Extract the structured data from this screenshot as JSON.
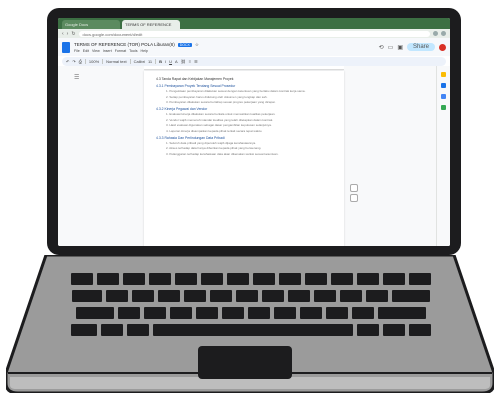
{
  "browser": {
    "tabs": [
      {
        "label": "Google Docs",
        "active": false
      },
      {
        "label": "TERMS OF REFERENCE",
        "active": true
      }
    ],
    "url": "docs.google.com/document/d/edit"
  },
  "docs": {
    "title": "TERMS OF REFERENCE (TOR) POLA Liburan(8)",
    "badge": "DOCX",
    "menus": [
      "File",
      "Edit",
      "View",
      "Insert",
      "Format",
      "Tools",
      "Help"
    ],
    "share_label": "Share"
  },
  "toolbar": {
    "zoom": "100%",
    "style": "Normal text",
    "font": "Calibri",
    "font_size": "11"
  },
  "document": {
    "lines": [
      {
        "kind": "heading",
        "text": "4.3  Tanda Rapat dan Kebijakan Manajemen Proyek"
      },
      {
        "kind": "section",
        "text": "4.3.1 Pembayaran Proyek Terutang Sesuai Prosedur"
      },
      {
        "kind": "line",
        "text": "1. Pengelolaan pembayaran dilakukan sesuai dengan ketentuan yang berlaku dalam kontrak kerja sama."
      },
      {
        "kind": "line",
        "text": "2. Setiap pembayaran harus didukung oleh dokumen yang lengkap dan sah."
      },
      {
        "kind": "line",
        "text": "3. Pembayaran dilakukan secara bertahap sesuai progres pekerjaan yang dicapai."
      },
      {
        "kind": "section",
        "text": "4.3.2 Kinerja Pegawai dan Vendor"
      },
      {
        "kind": "line",
        "text": "1. Evaluasi kinerja dilakukan secara berkala untuk memastikan kualitas pekerjaan."
      },
      {
        "kind": "line",
        "text": "2. Vendor wajib memenuhi standar kualitas yang telah ditetapkan dalam kontrak."
      },
      {
        "kind": "line",
        "text": "3. Hasil evaluasi digunakan sebagai dasar pengambilan keputusan selanjutnya."
      },
      {
        "kind": "line",
        "text": "4. Laporan kinerja disampaikan kepada pihak terkait secara tepat waktu."
      },
      {
        "kind": "section",
        "text": "4.3.3 Rahasia Dan Perlindungan Data Pribadi"
      },
      {
        "kind": "line",
        "text": "1. Seluruh data pribadi yang diperoleh wajib dijaga kerahasiaannya."
      },
      {
        "kind": "line",
        "text": "2. Akses terhadap data hanya diberikan kepada pihak yang berwenang."
      },
      {
        "kind": "line",
        "text": "3. Pelanggaran terhadap kerahasiaan data akan dikenakan sanksi sesuai ketentuan."
      }
    ]
  },
  "colors": {
    "bezel": "#1c1c1e",
    "base": "#9b9b9b",
    "tabbar": "#3c6f43",
    "accent": "#1a73e8"
  }
}
